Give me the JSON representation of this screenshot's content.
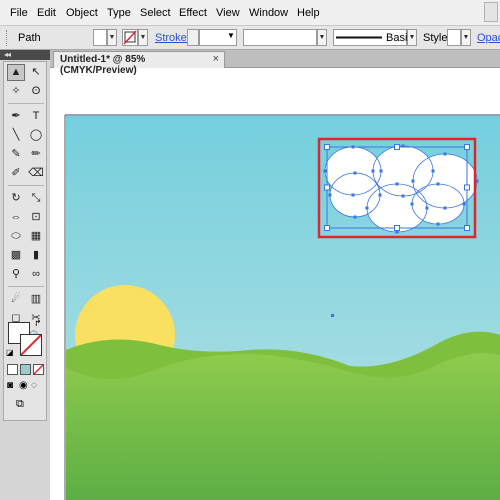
{
  "menubar": {
    "items": [
      "File",
      "Edit",
      "Object",
      "Type",
      "Select",
      "Effect",
      "View",
      "Window",
      "Help"
    ]
  },
  "controlbar": {
    "selection_type": "Path",
    "stroke_label": "Stroke:",
    "brush_label": "Basic",
    "style_label": "Style:",
    "opacity_label": "Opacity"
  },
  "document": {
    "tab_title": "Untitled-1* @ 85% (CMYK/Preview)",
    "close_glyph": "×"
  },
  "tools": [
    {
      "name": "selection-tool-icon",
      "glyph": "▲",
      "selected": true
    },
    {
      "name": "direct-selection-tool-icon",
      "glyph": "↖"
    },
    {
      "name": "magic-wand-tool-icon",
      "glyph": "✧"
    },
    {
      "name": "lasso-tool-icon",
      "glyph": "ʘ"
    },
    {
      "name": "pen-tool-icon",
      "glyph": "✒"
    },
    {
      "name": "type-tool-icon",
      "glyph": "T"
    },
    {
      "name": "line-segment-tool-icon",
      "glyph": "╲"
    },
    {
      "name": "ellipse-tool-icon",
      "glyph": "◯"
    },
    {
      "name": "paintbrush-tool-icon",
      "glyph": "✎"
    },
    {
      "name": "pencil-tool-icon",
      "glyph": "✏"
    },
    {
      "name": "blob-brush-tool-icon",
      "glyph": "✐"
    },
    {
      "name": "eraser-tool-icon",
      "glyph": "⌫"
    },
    {
      "name": "rotate-tool-icon",
      "glyph": "↻"
    },
    {
      "name": "scale-tool-icon",
      "glyph": "⤡"
    },
    {
      "name": "width-tool-icon",
      "glyph": "⇔"
    },
    {
      "name": "free-transform-tool-icon",
      "glyph": "⊡"
    },
    {
      "name": "shape-builder-tool-icon",
      "glyph": "⬭"
    },
    {
      "name": "perspective-grid-tool-icon",
      "glyph": "▦"
    },
    {
      "name": "mesh-tool-icon",
      "glyph": "▩"
    },
    {
      "name": "gradient-tool-icon",
      "glyph": "▮"
    },
    {
      "name": "eyedropper-tool-icon",
      "glyph": "⚲"
    },
    {
      "name": "blend-tool-icon",
      "glyph": "∞"
    },
    {
      "name": "symbol-sprayer-tool-icon",
      "glyph": "☄"
    },
    {
      "name": "column-graph-tool-icon",
      "glyph": "▥"
    },
    {
      "name": "artboard-tool-icon",
      "glyph": "◻"
    },
    {
      "name": "slice-tool-icon",
      "glyph": "✂"
    },
    {
      "name": "hand-tool-icon",
      "glyph": "✋"
    },
    {
      "name": "zoom-tool-icon",
      "glyph": "🔍"
    }
  ],
  "colors": {
    "sky_top": "#74cfdd",
    "sky_bottom": "#b9e3e4",
    "sun": "#f9e060",
    "hill_back": "#7fbf3e",
    "hill_front": "#8fcb4c",
    "ground_bottom": "#5cae44",
    "cloud_fill": "#ffffff",
    "selection_blue": "#3b76e0",
    "highlight_red": "#e0262c"
  }
}
